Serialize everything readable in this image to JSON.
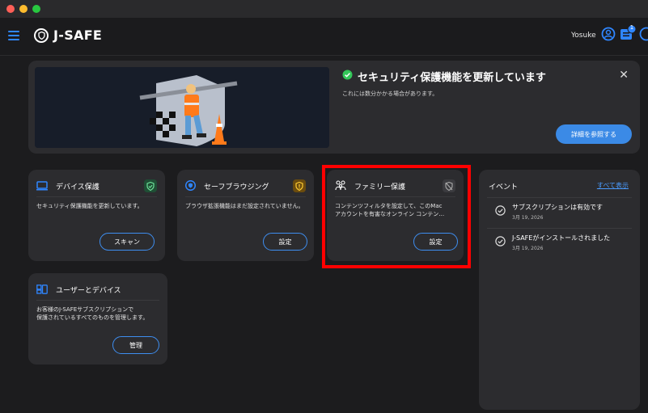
{
  "window": {
    "traffic_lights": [
      "#ff5f57",
      "#febc2e",
      "#28c840"
    ]
  },
  "app": {
    "name": "J-SAFE",
    "username": "Yosuke",
    "notification_count": "1"
  },
  "banner": {
    "title": "セキュリティ保護機能を更新しています",
    "subtitle": "これには数分かかる場合があります。",
    "button_label": "詳細を参照する",
    "status_icon": "check-circle-icon"
  },
  "cards": {
    "device": {
      "title": "デバイス保護",
      "desc": "セキュリティ保護機能を更新しています。",
      "button": "スキャン",
      "status_color": "#2e7d4f"
    },
    "safe_browsing": {
      "title": "セーフブラウジング",
      "desc": "ブラウザ拡張機能はまだ設定されていません。",
      "button": "設定",
      "status_color": "#b8860b"
    },
    "family": {
      "title": "ファミリー保護",
      "desc_line1": "コンテンツフィルタを設定して、このMac",
      "desc_line2": "アカウントを有害なオンライン コンテン…",
      "button": "設定"
    },
    "users_devices": {
      "title": "ユーザーとデバイス",
      "desc_line1": "お客様のJ-SAFEサブスクリプションで",
      "desc_line2": "保護されているすべてのものを管理します。",
      "button": "管理"
    }
  },
  "events": {
    "title": "イベント",
    "show_all": "すべて表示",
    "items": [
      {
        "title": "サブスクリプションは有効です",
        "date": "3月 19, 2026"
      },
      {
        "title": "J-SAFEがインストールされました",
        "date": "3月 19, 2026"
      }
    ]
  },
  "colors": {
    "accent": "#3b8ae6",
    "highlight": "#ff0000"
  }
}
